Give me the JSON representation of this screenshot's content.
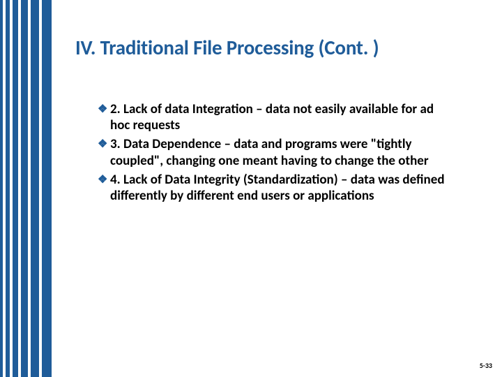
{
  "stripes": {
    "color": "#1F5C99",
    "bars": [
      4,
      6,
      8,
      10,
      12,
      14
    ],
    "gap": 4
  },
  "title": "IV. Traditional File Processing (Cont. )",
  "bullets": [
    "2. Lack of data Integration – data not easily available for ad hoc requests",
    "3. Data Dependence – data and programs were \"tightly coupled\", changing one meant having to change the other",
    "4. Lack of Data Integrity (Standardization) – data was defined differently by different end users or applications"
  ],
  "bullet_glyph": "❖",
  "page_number": "5-33"
}
